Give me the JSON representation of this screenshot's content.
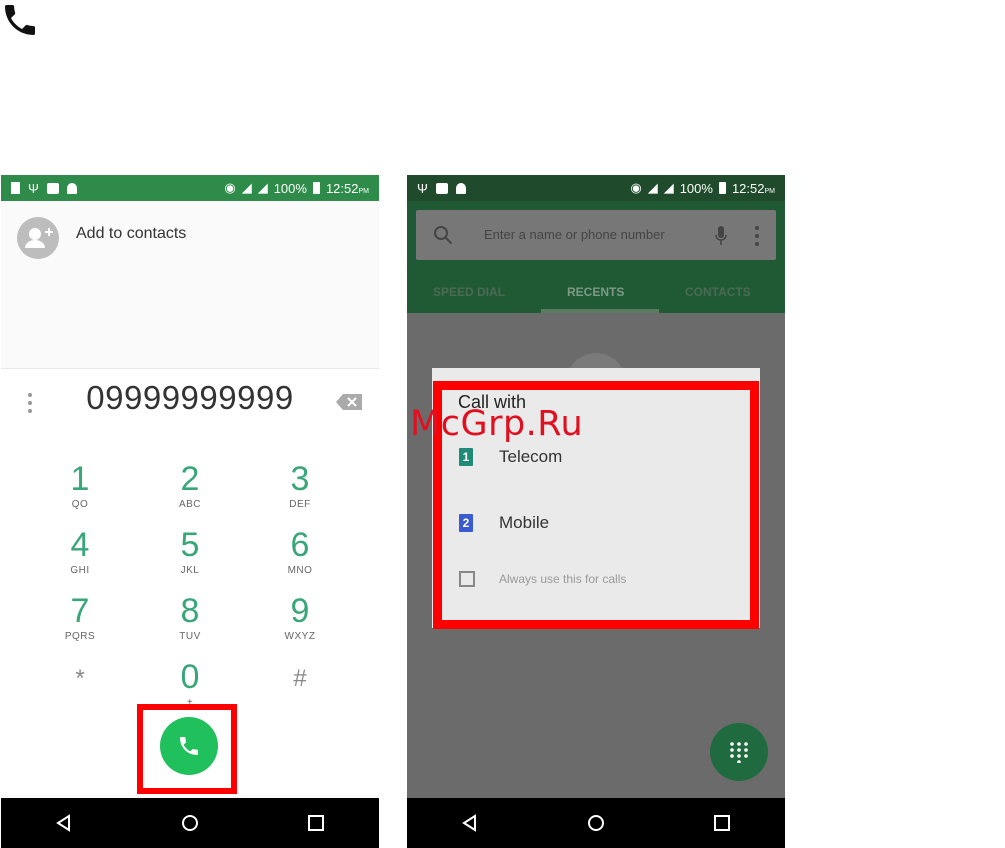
{
  "corner_icon": "phone-icon",
  "left_phone": {
    "status_bar": {
      "battery": "100%",
      "time": "12:52",
      "ampm": "PM"
    },
    "add_to_contacts": "Add to contacts",
    "dialed_number": "09999999999",
    "keys": [
      {
        "digit": "1",
        "letters": "QO"
      },
      {
        "digit": "2",
        "letters": "ABC"
      },
      {
        "digit": "3",
        "letters": "DEF"
      },
      {
        "digit": "4",
        "letters": "GHI"
      },
      {
        "digit": "5",
        "letters": "JKL"
      },
      {
        "digit": "6",
        "letters": "MNO"
      },
      {
        "digit": "7",
        "letters": "PQRS"
      },
      {
        "digit": "8",
        "letters": "TUV"
      },
      {
        "digit": "9",
        "letters": "WXYZ"
      },
      {
        "digit": "*",
        "letters": ""
      },
      {
        "digit": "0",
        "letters": "+"
      },
      {
        "digit": "#",
        "letters": ""
      }
    ],
    "accent_color": "#39a67a",
    "call_button_color": "#20c05c"
  },
  "right_phone": {
    "status_bar": {
      "battery": "100%",
      "time": "12:52",
      "ampm": "PM"
    },
    "search_placeholder": "Enter a name or phone number",
    "tabs": [
      "SPEED DIAL",
      "RECENTS",
      "CONTACTS"
    ],
    "dialog": {
      "title": "Call with",
      "options": [
        {
          "sim": "1",
          "label": "Telecom"
        },
        {
          "sim": "2",
          "label": "Mobile"
        }
      ],
      "checkbox_label": "Always use this for calls"
    }
  },
  "watermark": "McGrp.Ru",
  "highlight_color": "#ff0000"
}
